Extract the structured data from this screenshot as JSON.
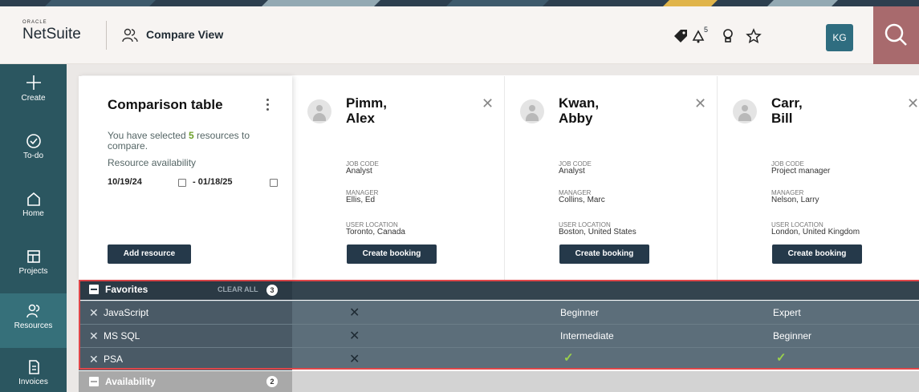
{
  "header": {
    "logo_small": "ORACLE",
    "logo_main": "NetSuite",
    "page_title": "Compare View",
    "notification_count": "5",
    "avatar_initials": "KG"
  },
  "sidebar": {
    "items": [
      {
        "label": "Create",
        "icon": "plus-icon"
      },
      {
        "label": "To-do",
        "icon": "check-circle-icon"
      },
      {
        "label": "Home",
        "icon": "home-icon"
      },
      {
        "label": "Projects",
        "icon": "projects-icon"
      },
      {
        "label": "Resources",
        "icon": "people-icon"
      },
      {
        "label": "Invoices",
        "icon": "invoice-icon"
      }
    ]
  },
  "summary": {
    "title": "Comparison table",
    "text_before": "You have selected ",
    "count": "5",
    "text_after": " resources to compare.",
    "availability_label": "Resource availability",
    "start_date": "10/19/24",
    "end_date": "- 01/18/25",
    "add_button": "Add resource"
  },
  "field_labels": {
    "job_code": "JOB CODE",
    "manager": "MANAGER",
    "location": "USER LOCATION"
  },
  "resources": [
    {
      "last": "Pimm,",
      "first": "Alex",
      "job_code": "Analyst",
      "manager": "Ellis, Ed",
      "location": "Toronto, Canada",
      "button": "Create booking"
    },
    {
      "last": "Kwan,",
      "first": "Abby",
      "job_code": "Analyst",
      "manager": "Collins, Marc",
      "location": "Boston, United States",
      "button": "Create booking"
    },
    {
      "last": "Carr,",
      "first": "Bill",
      "job_code": "Project manager",
      "manager": "Nelson, Larry",
      "location": "London, United Kingdom",
      "button": "Create booking"
    }
  ],
  "favorites": {
    "title": "Favorites",
    "clear_all": "CLEAR ALL",
    "count": "3",
    "skills": [
      {
        "name": "JavaScript",
        "values": [
          "none",
          "Beginner",
          "Expert"
        ]
      },
      {
        "name": "MS SQL",
        "values": [
          "none",
          "Intermediate",
          "Beginner"
        ]
      },
      {
        "name": "PSA",
        "values": [
          "none",
          "check",
          "check"
        ]
      }
    ]
  },
  "availability": {
    "title": "Availability",
    "count": "2"
  },
  "colors": {
    "sidebar": "#2b5660",
    "primary_button": "#25394a",
    "highlight_outline": "#e0474a",
    "check": "#9ad04c"
  }
}
